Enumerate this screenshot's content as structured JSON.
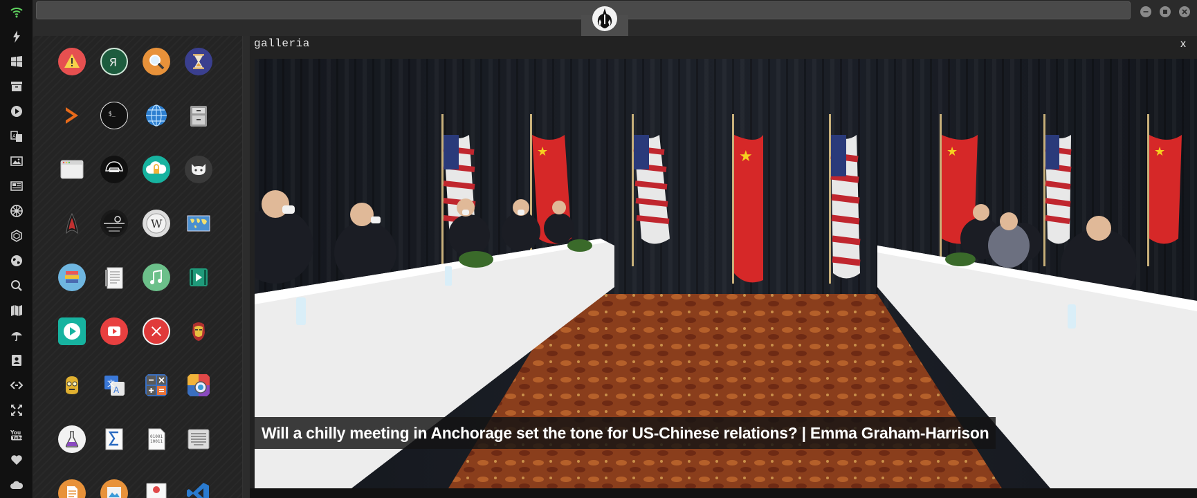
{
  "window": {
    "title_value": "",
    "emblem_icon": "rebel-alliance-icon",
    "buttons": [
      "minimize",
      "maximize",
      "close"
    ]
  },
  "dock": {
    "items": [
      {
        "icon": "wifi-icon"
      },
      {
        "icon": "lightning-icon"
      },
      {
        "icon": "windows-icon"
      },
      {
        "icon": "archive-icon"
      },
      {
        "icon": "play-circle-icon"
      },
      {
        "icon": "translate-icon"
      },
      {
        "icon": "image-icon"
      },
      {
        "icon": "newspaper-icon"
      },
      {
        "icon": "empire-icon"
      },
      {
        "icon": "hexagon-icon"
      },
      {
        "icon": "globe-icon"
      },
      {
        "icon": "search-icon"
      },
      {
        "icon": "map-icon"
      },
      {
        "icon": "umbrella-icon"
      },
      {
        "icon": "contacts-icon"
      },
      {
        "icon": "code-icon"
      },
      {
        "icon": "expand-icon"
      },
      {
        "icon": "youtube-icon"
      },
      {
        "icon": "heart-icon"
      },
      {
        "icon": "cloud-icon"
      }
    ]
  },
  "launcher": {
    "apps": [
      {
        "icon": "warning-icon",
        "color": "#e04848"
      },
      {
        "icon": "yandex-icon",
        "color": "#1d5c3e"
      },
      {
        "icon": "magnifier-icon",
        "color": "#e8923a"
      },
      {
        "icon": "hourglass-icon",
        "color": "#3a3f8f"
      },
      {
        "icon": "terminal-arrow-icon",
        "color": "#e86a1a"
      },
      {
        "icon": "terminal-icon",
        "color": "#111111"
      },
      {
        "icon": "web-globe-icon",
        "color": "#2d7fd0"
      },
      {
        "icon": "file-manager-icon",
        "color": "#888888"
      },
      {
        "icon": "browser-window-icon",
        "color": "#e8e8e8"
      },
      {
        "icon": "darth-vader-icon",
        "color": "#111111"
      },
      {
        "icon": "cloud-lock-icon",
        "color": "#17b3a0"
      },
      {
        "icon": "github-icon",
        "color": "#3a3a3a"
      },
      {
        "icon": "starfleet-icon",
        "color": "#1a1a1a"
      },
      {
        "icon": "death-star-icon",
        "color": "#1a1a1a"
      },
      {
        "icon": "wikipedia-icon",
        "color": "#dddddd"
      },
      {
        "icon": "world-map-icon",
        "color": "#4a8fd0"
      },
      {
        "icon": "books-icon",
        "color": "#6fb6e0"
      },
      {
        "icon": "notes-icon",
        "color": "#dddddd"
      },
      {
        "icon": "music-icon",
        "color": "#6cc08a"
      },
      {
        "icon": "video-icon",
        "color": "#1f9a7a"
      },
      {
        "icon": "media-player-icon",
        "color": "#17b3a0"
      },
      {
        "icon": "youtube-app-icon",
        "color": "#e84040"
      },
      {
        "icon": "close-circle-icon",
        "color": "#e03a3a"
      },
      {
        "icon": "iron-man-icon",
        "color": "#b03030"
      },
      {
        "icon": "c3po-icon",
        "color": "#e0b030"
      },
      {
        "icon": "translator-icon",
        "color": "#3a78d8"
      },
      {
        "icon": "calculator-icon",
        "color": "#3a6fc0"
      },
      {
        "icon": "color-picker-icon",
        "color": "#e04848"
      },
      {
        "icon": "chemistry-icon",
        "color": "#f2f2f2"
      },
      {
        "icon": "sigma-icon",
        "color": "#f2f2f2"
      },
      {
        "icon": "binary-file-icon",
        "color": "#f2f2f2"
      },
      {
        "icon": "keyboard-icon",
        "color": "#d8d8d8"
      },
      {
        "icon": "document-icon",
        "color": "#e8923a"
      },
      {
        "icon": "photo-viewer-icon",
        "color": "#e8923a"
      },
      {
        "icon": "presentation-icon",
        "color": "#f2f2f2"
      },
      {
        "icon": "vscode-icon",
        "color": "#2a7bd0"
      }
    ]
  },
  "galleria": {
    "title": "galleria",
    "close_label": "x",
    "caption": "Will a chilly meeting in Anchorage set the tone for US-Chinese relations? | Emma Graham-Harrison"
  }
}
